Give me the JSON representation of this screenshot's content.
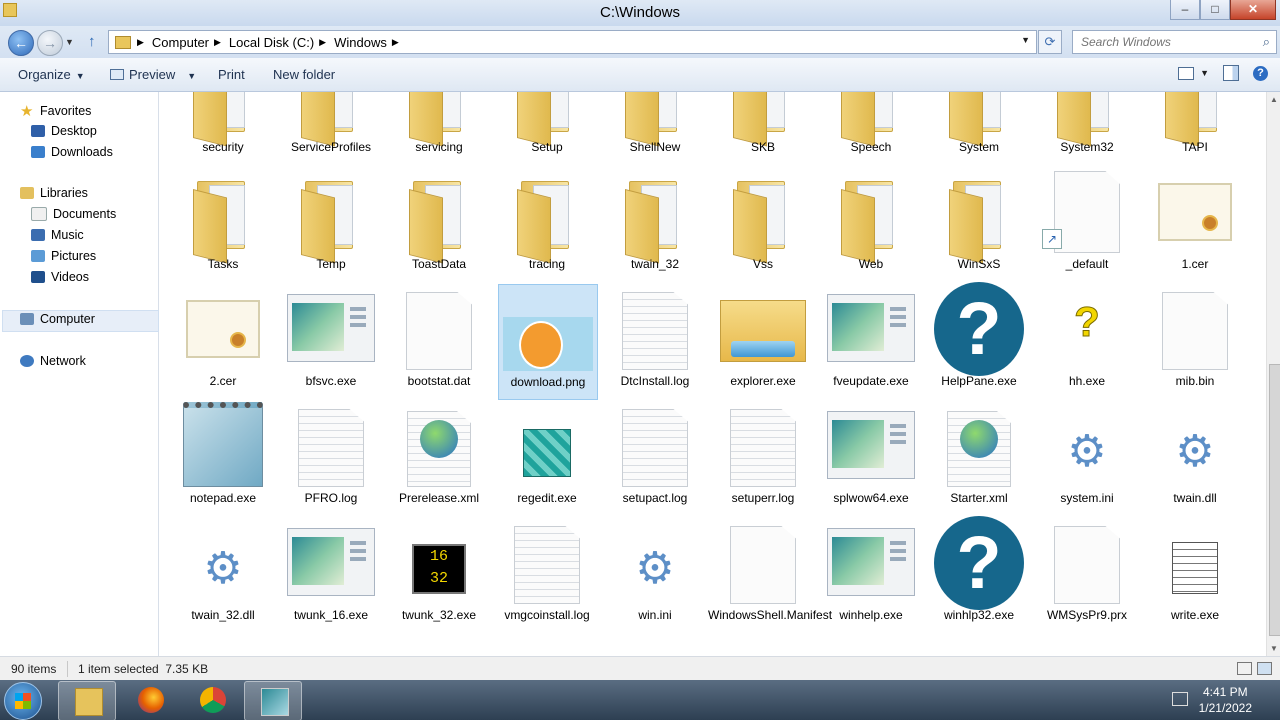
{
  "window": {
    "title": "C:\\Windows"
  },
  "address": {
    "crumbs": [
      "Computer",
      "Local Disk (C:)",
      "Windows"
    ]
  },
  "search": {
    "placeholder": "Search Windows"
  },
  "toolbar": {
    "organize": "Organize",
    "preview": "Preview",
    "print": "Print",
    "new_folder": "New folder"
  },
  "nav": {
    "favorites": "Favorites",
    "desktop": "Desktop",
    "downloads": "Downloads",
    "libraries": "Libraries",
    "documents": "Documents",
    "music": "Music",
    "pictures": "Pictures",
    "videos": "Videos",
    "computer": "Computer",
    "network": "Network"
  },
  "files": [
    {
      "name": "security",
      "icon": "folder-icon"
    },
    {
      "name": "ServiceProfiles",
      "icon": "folder-icon"
    },
    {
      "name": "servicing",
      "icon": "folder-icon"
    },
    {
      "name": "Setup",
      "icon": "folder-icon"
    },
    {
      "name": "ShellNew",
      "icon": "folder-icon"
    },
    {
      "name": "SKB",
      "icon": "folder-icon"
    },
    {
      "name": "Speech",
      "icon": "folder-icon"
    },
    {
      "name": "System",
      "icon": "folder-icon"
    },
    {
      "name": "System32",
      "icon": "folder-icon"
    },
    {
      "name": "TAPI",
      "icon": "folder-icon"
    },
    {
      "name": "Tasks",
      "icon": "folder-icon"
    },
    {
      "name": "Temp",
      "icon": "folder-icon"
    },
    {
      "name": "ToastData",
      "icon": "folder-icon"
    },
    {
      "name": "tracing",
      "icon": "folder-icon"
    },
    {
      "name": "twain_32",
      "icon": "folder-icon"
    },
    {
      "name": "Vss",
      "icon": "folder-icon"
    },
    {
      "name": "Web",
      "icon": "folder-icon"
    },
    {
      "name": "WinSxS",
      "icon": "folder-icon"
    },
    {
      "name": "_default",
      "icon": "shortcut-file-icon"
    },
    {
      "name": "1.cer",
      "icon": "certificate-icon"
    },
    {
      "name": "2.cer",
      "icon": "certificate-icon"
    },
    {
      "name": "bfsvc.exe",
      "icon": "application-icon"
    },
    {
      "name": "bootstat.dat",
      "icon": "blank-file-icon"
    },
    {
      "name": "download.png",
      "icon": "image-thumbnail-icon",
      "selected": true
    },
    {
      "name": "DtcInstall.log",
      "icon": "text-file-icon"
    },
    {
      "name": "explorer.exe",
      "icon": "explorer-folder-icon"
    },
    {
      "name": "fveupdate.exe",
      "icon": "application-icon"
    },
    {
      "name": "HelpPane.exe",
      "icon": "help-question-icon"
    },
    {
      "name": "hh.exe",
      "icon": "help-file-icon"
    },
    {
      "name": "mib.bin",
      "icon": "blank-file-icon"
    },
    {
      "name": "notepad.exe",
      "icon": "notepad-icon"
    },
    {
      "name": "PFRO.log",
      "icon": "text-file-icon"
    },
    {
      "name": "Prerelease.xml",
      "icon": "xml-globe-icon"
    },
    {
      "name": "regedit.exe",
      "icon": "registry-editor-icon"
    },
    {
      "name": "setupact.log",
      "icon": "text-file-icon"
    },
    {
      "name": "setuperr.log",
      "icon": "text-file-icon"
    },
    {
      "name": "splwow64.exe",
      "icon": "application-icon"
    },
    {
      "name": "Starter.xml",
      "icon": "xml-globe-icon"
    },
    {
      "name": "system.ini",
      "icon": "settings-gear-icon"
    },
    {
      "name": "twain.dll",
      "icon": "settings-gear-icon"
    },
    {
      "name": "twain_32.dll",
      "icon": "settings-gear-icon"
    },
    {
      "name": "twunk_16.exe",
      "icon": "application-icon"
    },
    {
      "name": "twunk_32.exe",
      "icon": "twunk-icon"
    },
    {
      "name": "vmgcoinstall.log",
      "icon": "text-file-icon"
    },
    {
      "name": "win.ini",
      "icon": "settings-gear-icon"
    },
    {
      "name": "WindowsShell.Manifest",
      "icon": "blank-file-icon"
    },
    {
      "name": "winhelp.exe",
      "icon": "application-icon"
    },
    {
      "name": "winhlp32.exe",
      "icon": "help-question-icon"
    },
    {
      "name": "WMSysPr9.prx",
      "icon": "blank-file-icon"
    },
    {
      "name": "write.exe",
      "icon": "wordpad-icon"
    }
  ],
  "status": {
    "count": "90 items",
    "selection": "1 item selected  7.35 KB"
  },
  "taskbar": {
    "time": "4:41 PM",
    "date": "1/21/2022"
  },
  "colors": {
    "selection": "#cce4f7",
    "taskbar": "#3b4d62"
  }
}
